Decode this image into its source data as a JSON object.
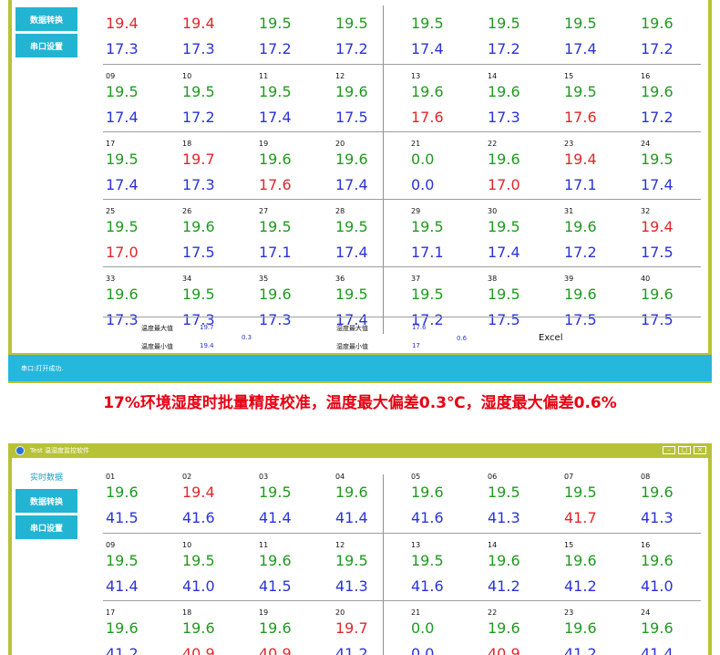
{
  "panel1": {
    "sidebar": [
      "数据转换",
      "串口设置"
    ],
    "rows": [
      [
        {
          "id": "",
          "v1": "19.4",
          "v1c": "red",
          "v2": "17.3",
          "v2c": "blue"
        },
        {
          "id": "",
          "v1": "19.4",
          "v1c": "red",
          "v2": "17.3",
          "v2c": "blue"
        },
        {
          "id": "",
          "v1": "19.5",
          "v1c": "green",
          "v2": "17.2",
          "v2c": "blue"
        },
        {
          "id": "",
          "v1": "19.5",
          "v1c": "green",
          "v2": "17.2",
          "v2c": "blue"
        },
        {
          "id": "",
          "v1": "19.5",
          "v1c": "green",
          "v2": "17.4",
          "v2c": "blue"
        },
        {
          "id": "",
          "v1": "19.5",
          "v1c": "green",
          "v2": "17.2",
          "v2c": "blue"
        },
        {
          "id": "",
          "v1": "19.5",
          "v1c": "green",
          "v2": "17.4",
          "v2c": "blue"
        },
        {
          "id": "",
          "v1": "19.6",
          "v1c": "green",
          "v2": "17.2",
          "v2c": "blue"
        }
      ],
      [
        {
          "id": "09",
          "v1": "19.5",
          "v1c": "green",
          "v2": "17.4",
          "v2c": "blue"
        },
        {
          "id": "10",
          "v1": "19.5",
          "v1c": "green",
          "v2": "17.2",
          "v2c": "blue"
        },
        {
          "id": "11",
          "v1": "19.5",
          "v1c": "green",
          "v2": "17.4",
          "v2c": "blue"
        },
        {
          "id": "12",
          "v1": "19.6",
          "v1c": "green",
          "v2": "17.5",
          "v2c": "blue"
        },
        {
          "id": "13",
          "v1": "19.6",
          "v1c": "green",
          "v2": "17.6",
          "v2c": "red"
        },
        {
          "id": "14",
          "v1": "19.6",
          "v1c": "green",
          "v2": "17.3",
          "v2c": "blue"
        },
        {
          "id": "15",
          "v1": "19.5",
          "v1c": "green",
          "v2": "17.6",
          "v2c": "red"
        },
        {
          "id": "16",
          "v1": "19.6",
          "v1c": "green",
          "v2": "17.2",
          "v2c": "blue"
        }
      ],
      [
        {
          "id": "17",
          "v1": "19.5",
          "v1c": "green",
          "v2": "17.4",
          "v2c": "blue"
        },
        {
          "id": "18",
          "v1": "19.7",
          "v1c": "red",
          "v2": "17.3",
          "v2c": "blue"
        },
        {
          "id": "19",
          "v1": "19.6",
          "v1c": "green",
          "v2": "17.6",
          "v2c": "red"
        },
        {
          "id": "20",
          "v1": "19.6",
          "v1c": "green",
          "v2": "17.4",
          "v2c": "blue"
        },
        {
          "id": "21",
          "v1": "0.0",
          "v1c": "green",
          "v2": "0.0",
          "v2c": "blue"
        },
        {
          "id": "22",
          "v1": "19.6",
          "v1c": "green",
          "v2": "17.0",
          "v2c": "red"
        },
        {
          "id": "23",
          "v1": "19.4",
          "v1c": "red",
          "v2": "17.1",
          "v2c": "blue"
        },
        {
          "id": "24",
          "v1": "19.5",
          "v1c": "green",
          "v2": "17.4",
          "v2c": "blue"
        }
      ],
      [
        {
          "id": "25",
          "v1": "19.5",
          "v1c": "green",
          "v2": "17.0",
          "v2c": "red"
        },
        {
          "id": "26",
          "v1": "19.6",
          "v1c": "green",
          "v2": "17.5",
          "v2c": "blue"
        },
        {
          "id": "27",
          "v1": "19.5",
          "v1c": "green",
          "v2": "17.1",
          "v2c": "blue"
        },
        {
          "id": "28",
          "v1": "19.5",
          "v1c": "green",
          "v2": "17.4",
          "v2c": "blue"
        },
        {
          "id": "29",
          "v1": "19.5",
          "v1c": "green",
          "v2": "17.1",
          "v2c": "blue"
        },
        {
          "id": "30",
          "v1": "19.5",
          "v1c": "green",
          "v2": "17.4",
          "v2c": "blue"
        },
        {
          "id": "31",
          "v1": "19.6",
          "v1c": "green",
          "v2": "17.2",
          "v2c": "blue"
        },
        {
          "id": "32",
          "v1": "19.4",
          "v1c": "red",
          "v2": "17.5",
          "v2c": "blue"
        }
      ],
      [
        {
          "id": "33",
          "v1": "19.6",
          "v1c": "green",
          "v2": "17.3",
          "v2c": "blue"
        },
        {
          "id": "34",
          "v1": "19.5",
          "v1c": "green",
          "v2": "17.3",
          "v2c": "blue"
        },
        {
          "id": "35",
          "v1": "19.6",
          "v1c": "green",
          "v2": "17.3",
          "v2c": "blue"
        },
        {
          "id": "36",
          "v1": "19.5",
          "v1c": "green",
          "v2": "17.4",
          "v2c": "blue"
        },
        {
          "id": "37",
          "v1": "19.5",
          "v1c": "green",
          "v2": "17.2",
          "v2c": "blue"
        },
        {
          "id": "38",
          "v1": "19.5",
          "v1c": "green",
          "v2": "17.5",
          "v2c": "blue"
        },
        {
          "id": "39",
          "v1": "19.6",
          "v1c": "green",
          "v2": "17.5",
          "v2c": "blue"
        },
        {
          "id": "40",
          "v1": "19.6",
          "v1c": "green",
          "v2": "17.5",
          "v2c": "blue"
        }
      ]
    ],
    "stats": {
      "temp_max_label": "温度最大值",
      "temp_max": "19.7",
      "temp_min_label": "温度最小值",
      "temp_min": "19.4",
      "temp_diff": "0.3",
      "hum_max_label": "湿度最大值",
      "hum_max": "17.6",
      "hum_min_label": "湿度最小值",
      "hum_min": "17",
      "hum_diff": "0.6",
      "excel_label": "Excel"
    },
    "status": "串口:打开成功."
  },
  "headline": "17%环境湿度时批量精度校准，温度最大偏差0.3℃，湿度最大偏差0.6%",
  "panel2": {
    "title": "Test 温湿度监控软件",
    "window_controls": [
      "–",
      "□",
      "×"
    ],
    "sidebar": [
      "实时数据",
      "数据转换",
      "串口设置"
    ],
    "rows": [
      [
        {
          "id": "01",
          "v1": "19.6",
          "v1c": "green",
          "v2": "41.5",
          "v2c": "blue"
        },
        {
          "id": "02",
          "v1": "19.4",
          "v1c": "red",
          "v2": "41.6",
          "v2c": "blue"
        },
        {
          "id": "03",
          "v1": "19.5",
          "v1c": "green",
          "v2": "41.4",
          "v2c": "blue"
        },
        {
          "id": "04",
          "v1": "19.6",
          "v1c": "green",
          "v2": "41.4",
          "v2c": "blue"
        },
        {
          "id": "05",
          "v1": "19.6",
          "v1c": "green",
          "v2": "41.6",
          "v2c": "blue"
        },
        {
          "id": "06",
          "v1": "19.5",
          "v1c": "green",
          "v2": "41.3",
          "v2c": "blue"
        },
        {
          "id": "07",
          "v1": "19.5",
          "v1c": "green",
          "v2": "41.7",
          "v2c": "red"
        },
        {
          "id": "08",
          "v1": "19.6",
          "v1c": "green",
          "v2": "41.3",
          "v2c": "blue"
        }
      ],
      [
        {
          "id": "09",
          "v1": "19.5",
          "v1c": "green",
          "v2": "41.4",
          "v2c": "blue"
        },
        {
          "id": "10",
          "v1": "19.5",
          "v1c": "green",
          "v2": "41.0",
          "v2c": "blue"
        },
        {
          "id": "11",
          "v1": "19.6",
          "v1c": "green",
          "v2": "41.5",
          "v2c": "blue"
        },
        {
          "id": "12",
          "v1": "19.5",
          "v1c": "green",
          "v2": "41.3",
          "v2c": "blue"
        },
        {
          "id": "13",
          "v1": "19.5",
          "v1c": "green",
          "v2": "41.6",
          "v2c": "blue"
        },
        {
          "id": "14",
          "v1": "19.6",
          "v1c": "green",
          "v2": "41.2",
          "v2c": "blue"
        },
        {
          "id": "15",
          "v1": "19.6",
          "v1c": "green",
          "v2": "41.2",
          "v2c": "blue"
        },
        {
          "id": "16",
          "v1": "19.6",
          "v1c": "green",
          "v2": "41.0",
          "v2c": "blue"
        }
      ],
      [
        {
          "id": "17",
          "v1": "19.6",
          "v1c": "green",
          "v2": "41.2",
          "v2c": "blue"
        },
        {
          "id": "18",
          "v1": "19.6",
          "v1c": "green",
          "v2": "40.9",
          "v2c": "red"
        },
        {
          "id": "19",
          "v1": "19.6",
          "v1c": "green",
          "v2": "40.9",
          "v2c": "red"
        },
        {
          "id": "20",
          "v1": "19.7",
          "v1c": "red",
          "v2": "41.2",
          "v2c": "blue"
        },
        {
          "id": "21",
          "v1": "0.0",
          "v1c": "green",
          "v2": "0.0",
          "v2c": "blue"
        },
        {
          "id": "22",
          "v1": "19.6",
          "v1c": "green",
          "v2": "40.9",
          "v2c": "red"
        },
        {
          "id": "23",
          "v1": "19.6",
          "v1c": "green",
          "v2": "41.2",
          "v2c": "blue"
        },
        {
          "id": "24",
          "v1": "19.6",
          "v1c": "green",
          "v2": "41.4",
          "v2c": "blue"
        }
      ]
    ]
  }
}
